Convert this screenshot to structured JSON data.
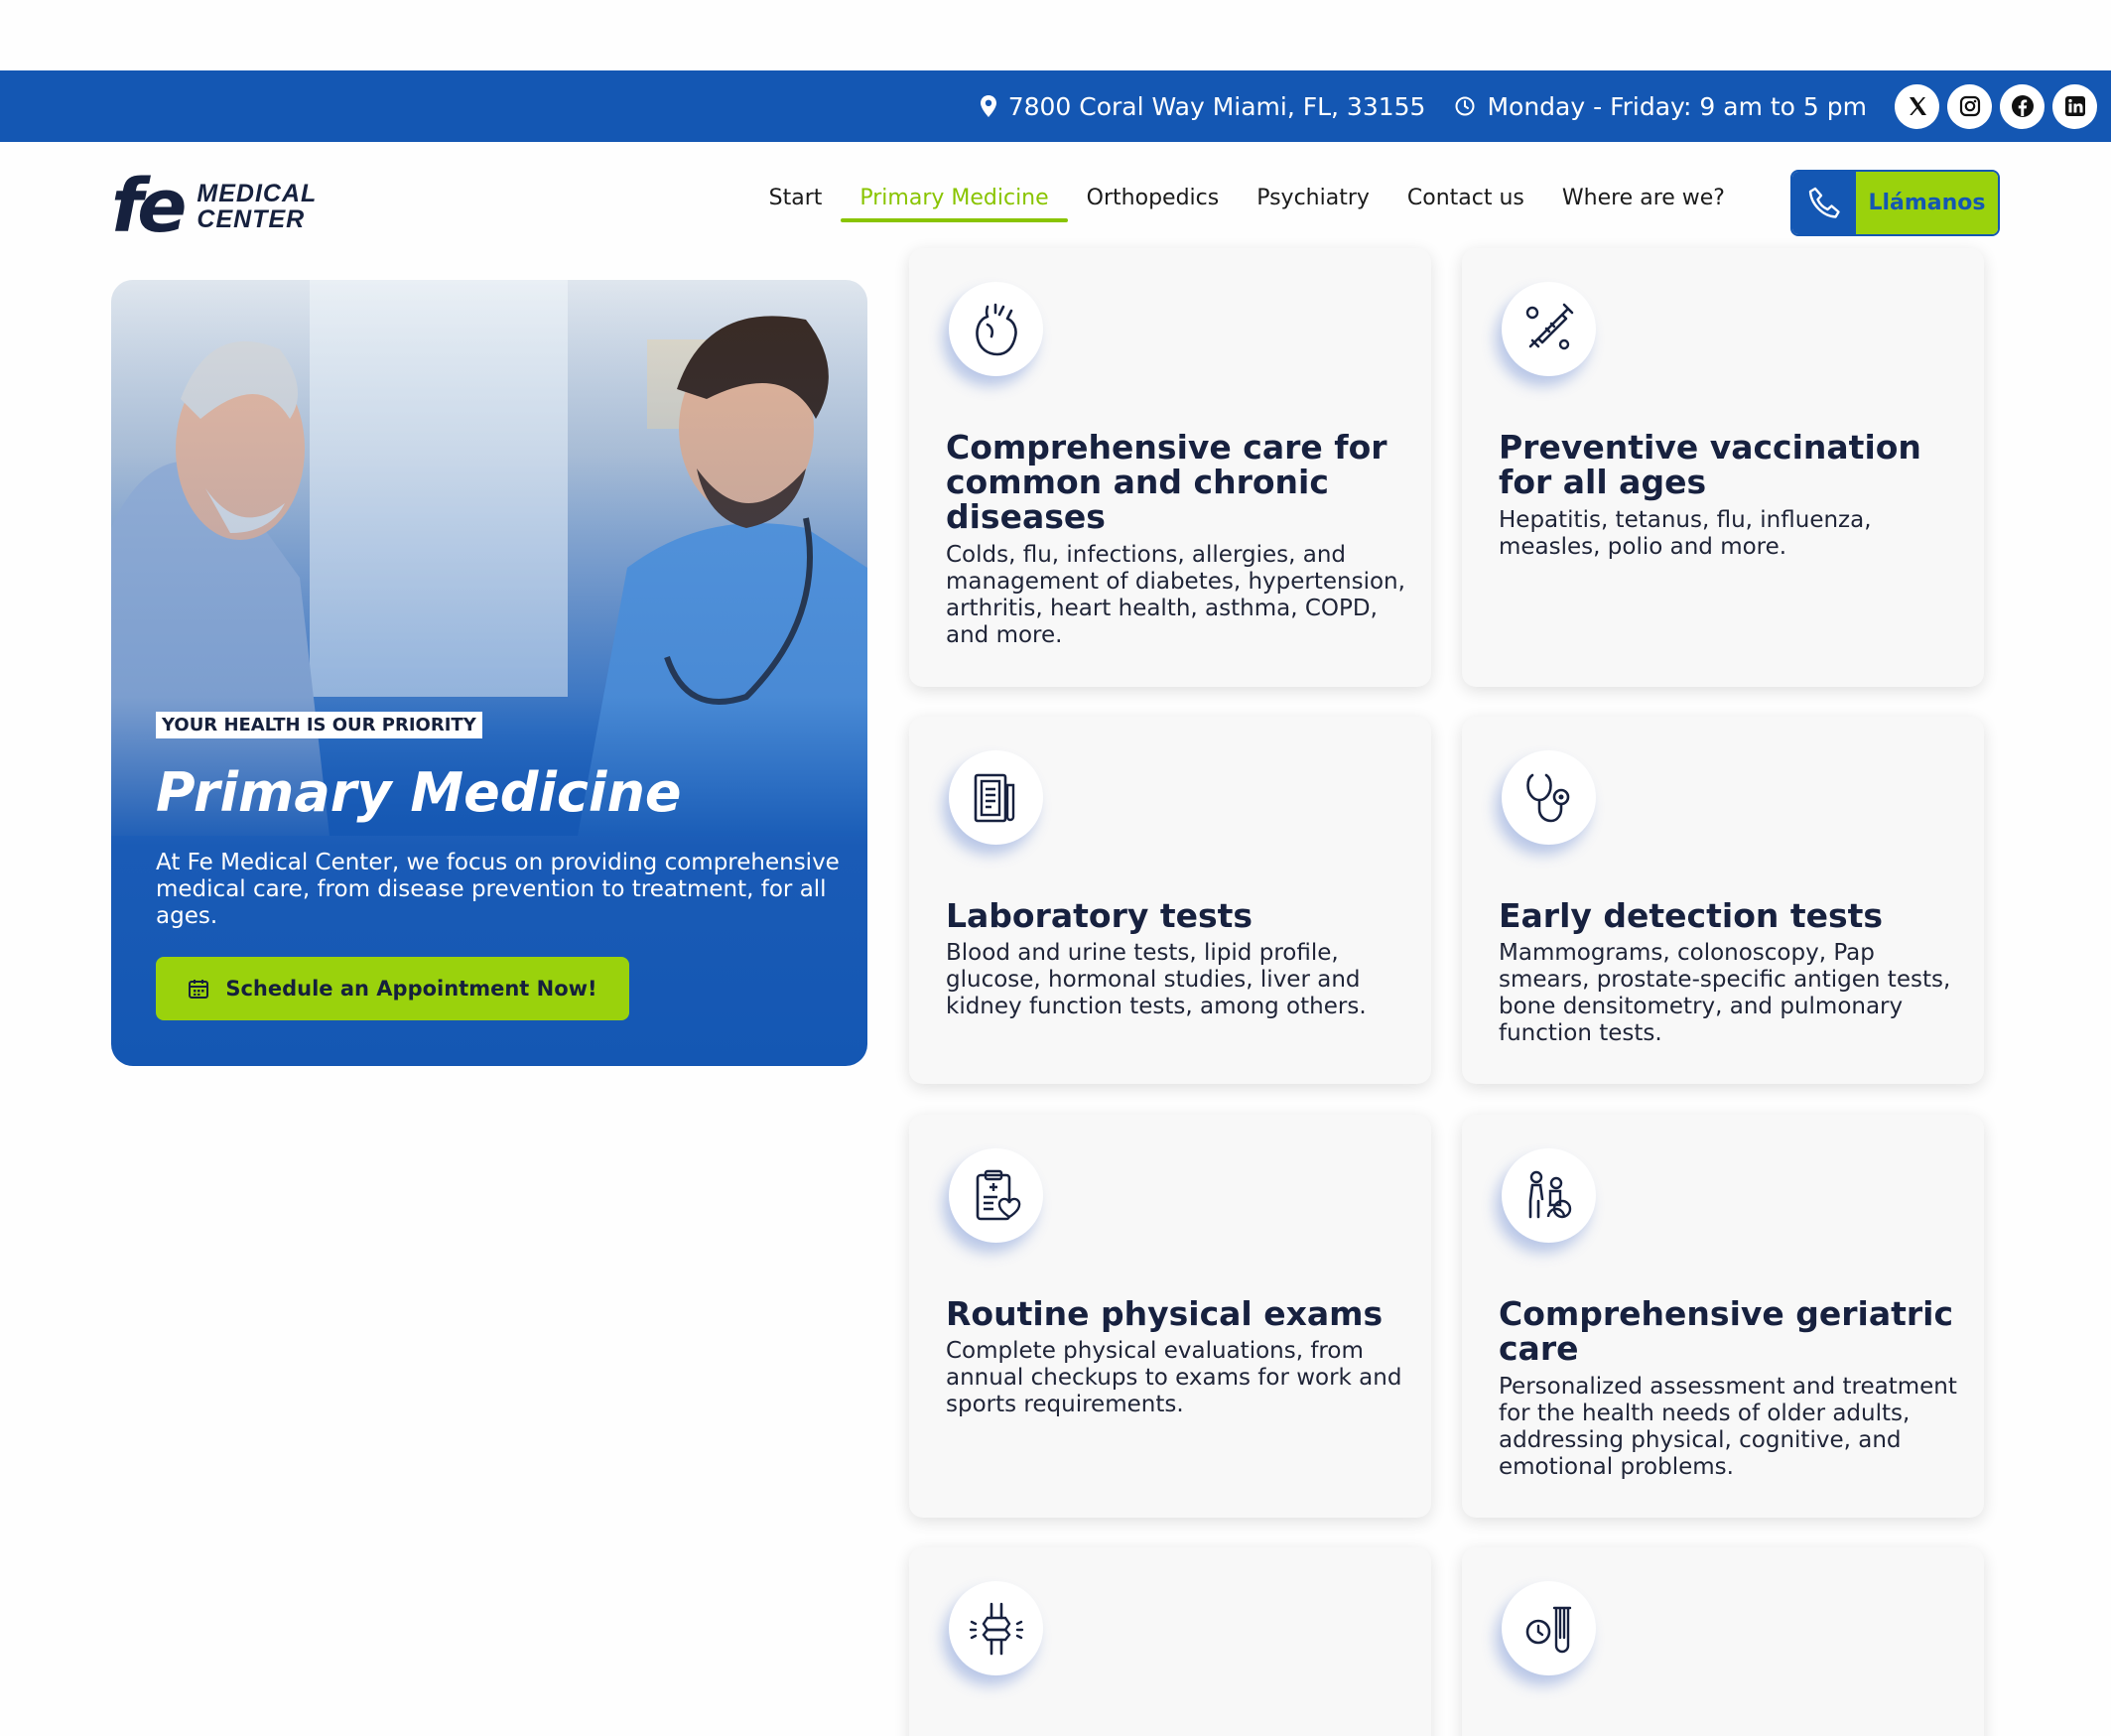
{
  "topbar": {
    "address": "7800 Coral Way Miami, FL, 33155",
    "hours": "Monday - Friday: 9 am to 5 pm",
    "social": [
      "x-icon",
      "instagram-icon",
      "facebook-icon",
      "linkedin-icon"
    ]
  },
  "header": {
    "logo_mark": "fe",
    "logo_line1": "MEDICAL",
    "logo_line2": "CENTER",
    "nav": [
      "Start",
      "Primary Medicine",
      "Orthopedics",
      "Psychiatry",
      "Contact us",
      "Where are we?"
    ],
    "active_nav": "Primary Medicine",
    "call_label": "Llámanos"
  },
  "hero": {
    "badge": "YOUR HEALTH IS OUR PRIORITY",
    "title": "Primary Medicine",
    "description": "At Fe Medical Center, we focus on providing comprehensive medical care, from disease prevention to treatment, for all ages.",
    "cta": "Schedule an Appointment Now!"
  },
  "services": [
    {
      "icon": "heart-icon",
      "title": "Comprehensive care for common and chronic diseases",
      "desc": "Colds, flu, infections, allergies, and management of diabetes, hypertension, arthritis, heart health, asthma, COPD, and more."
    },
    {
      "icon": "syringe-icon",
      "title": "Preventive vaccination for all ages",
      "desc": "Hepatitis, tetanus, flu, influenza, measles, polio and more."
    },
    {
      "icon": "lab-report-icon",
      "title": "Laboratory tests",
      "desc": "Blood and urine tests, lipid profile, glucose, hormonal studies, liver and kidney function tests, among others."
    },
    {
      "icon": "stethoscope-icon",
      "title": "Early detection tests",
      "desc": "Mammograms, colonoscopy, Pap smears, prostate-specific antigen tests, bone densitometry, and pulmonary function tests."
    },
    {
      "icon": "clipboard-heart-icon",
      "title": "Routine physical exams",
      "desc": "Complete physical evaluations, from annual checkups to exams for work and sports requirements."
    },
    {
      "icon": "geriatric-care-icon",
      "title": "Comprehensive geriatric care",
      "desc": "Personalized assessment and treatment for the health needs of older adults, addressing physical, cognitive, and emotional problems."
    },
    {
      "icon": "joint-icon",
      "title": "",
      "desc": ""
    },
    {
      "icon": "clock-test-tube-icon",
      "title": "",
      "desc": ""
    }
  ],
  "colors": {
    "brand_blue": "#1457b3",
    "accent_green": "#9ad20c",
    "nav_active": "#89c400",
    "navy_text": "#17213f"
  }
}
